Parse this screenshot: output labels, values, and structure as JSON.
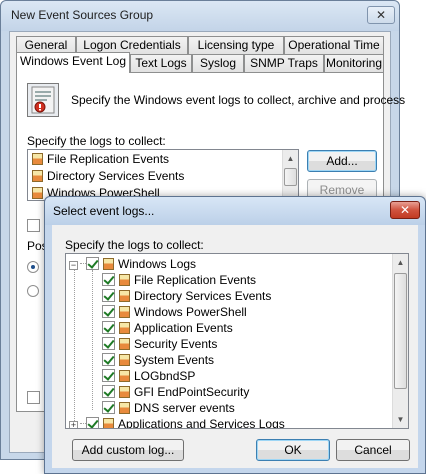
{
  "main_window": {
    "title": "New Event Sources Group",
    "tabs_row1": [
      "General",
      "Logon Credentials",
      "Licensing type",
      "Operational Time"
    ],
    "tabs_row2": [
      "Windows Event Log",
      "Text Logs",
      "Syslog",
      "SNMP Traps",
      "Monitoring"
    ],
    "active_tab": "Windows Event Log",
    "description": "Specify the Windows event logs to collect, archive and process",
    "logs_label": "Specify the logs to collect:",
    "logs": [
      "File Replication Events",
      "Directory Services Events",
      "Windows PowerShell"
    ],
    "add_button": "Add...",
    "remove_button": "Remove",
    "partial_label": "Post"
  },
  "dialog": {
    "title": "Select event logs...",
    "label": "Specify the logs to collect:",
    "tree": {
      "root": "Windows Logs",
      "children": [
        "File Replication Events",
        "Directory Services Events",
        "Windows PowerShell",
        "Application Events",
        "Security Events",
        "System Events",
        "LOGbndSP",
        "GFI EndPointSecurity",
        "DNS server events"
      ],
      "next_root": "Applications and Services Logs"
    },
    "add_custom_button": "Add custom log...",
    "ok_button": "OK",
    "cancel_button": "Cancel"
  }
}
